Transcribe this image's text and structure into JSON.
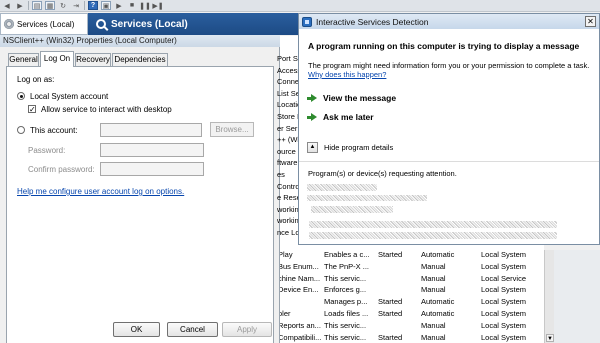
{
  "mmc": {
    "tree_header": "Services (Local)",
    "results_header": "Services (Local)",
    "toolbar": [
      "back-icon",
      "forward-icon",
      "console-tree-icon",
      "properties-icon",
      "refresh-icon",
      "export-icon",
      "help-icon",
      "console-icon",
      "play-icon",
      "stop-icon",
      "pause-icon",
      "restart-icon"
    ],
    "strip_labels": [
      "Port Sh",
      "Access",
      "Conne",
      "List Se",
      "Locatio",
      "Store I",
      "er Ser",
      "++ (Wi",
      "ource E",
      "ftware",
      "es",
      "Contro",
      "e Rese",
      "workin",
      "workin",
      "nce Lo"
    ],
    "services": [
      {
        "name": "Play",
        "desc": "Enables a c...",
        "status": "Started",
        "startup": "Automatic",
        "logon": "Local System"
      },
      {
        "name": "Bus Enum...",
        "desc": "The PnP-X ...",
        "status": "",
        "startup": "Manual",
        "logon": "Local System"
      },
      {
        "name": "chine Nam...",
        "desc": "This servic...",
        "status": "",
        "startup": "Manual",
        "logon": "Local Service"
      },
      {
        "name": "Device En...",
        "desc": "Enforces g...",
        "status": "",
        "startup": "Manual",
        "logon": "Local System"
      },
      {
        "name": "",
        "desc": "Manages p...",
        "status": "Started",
        "startup": "Automatic",
        "logon": "Local System"
      },
      {
        "name": "oler",
        "desc": "Loads files ...",
        "status": "Started",
        "startup": "Automatic",
        "logon": "Local System"
      },
      {
        "name": "Reports an...",
        "desc": "This servic...",
        "status": "",
        "startup": "Manual",
        "logon": "Local System"
      },
      {
        "name": "Compatibili...",
        "desc": "This servic...",
        "status": "Started",
        "startup": "Manual",
        "logon": "Local System"
      }
    ]
  },
  "props": {
    "title": "NSClient++ (Win32) Properties (Local Computer)",
    "tabs": [
      "General",
      "Log On",
      "Recovery",
      "Dependencies"
    ],
    "active_tab": "Log On",
    "log_on_as": "Log on as:",
    "local_system": "Local System account",
    "allow_interact": "Allow service to interact with desktop",
    "this_account": "This account:",
    "browse": "Browse...",
    "password": "Password:",
    "confirm_password": "Confirm password:",
    "help_link": "Help me configure user account log on options.",
    "ok": "OK",
    "cancel": "Cancel",
    "apply": "Apply"
  },
  "isd": {
    "title": "Interactive Services Detection",
    "close": "✕",
    "heading": "A program running on this computer is trying to display a message",
    "body": "The program might need information form you or your permission to complete a task.",
    "why_link": "Why does this happen?",
    "view_message": "View the message",
    "ask_later": "Ask me later",
    "toggle_glyph": "▲",
    "hide_details": "Hide program details",
    "devices_label": "Program(s) or device(s) requesting attention."
  },
  "colors": {
    "results_header": "#1d4b85",
    "link": "#0645ad",
    "green_arrow": "#2e8b2e"
  }
}
